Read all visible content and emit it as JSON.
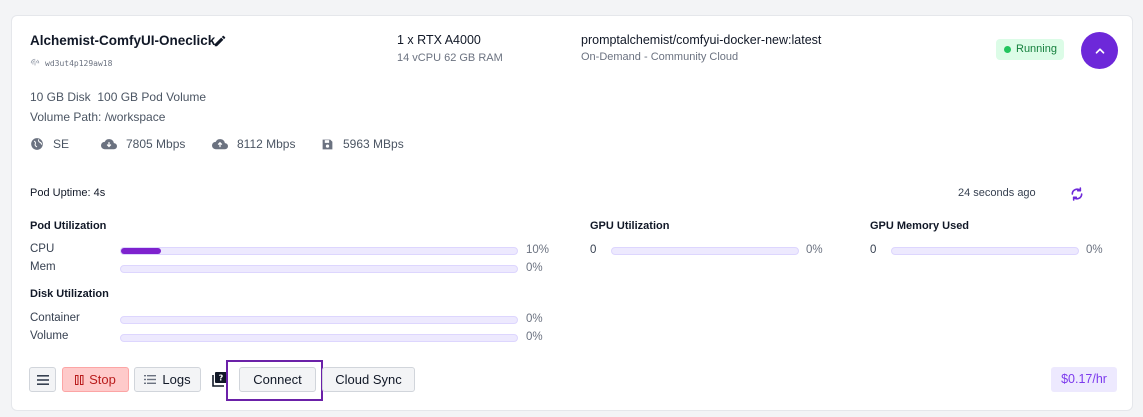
{
  "pod": {
    "name": "Alchemist-ComfyUI-Oneclick",
    "id": "wd3ut4p129aw18",
    "gpu": "1 x RTX A4000",
    "cpu_ram": "14 vCPU 62 GB RAM",
    "image": "promptalchemist/comfyui-docker-new:latest",
    "cloud": "On-Demand - Community Cloud",
    "status": "Running",
    "disk": "10 GB Disk",
    "pod_volume": "100 GB Pod Volume",
    "volume_path": "Volume Path: /workspace"
  },
  "stats": {
    "region": "SE",
    "download": "7805 Mbps",
    "upload": "8112 Mbps",
    "disk_speed": "5963 MBps"
  },
  "uptime": "Pod Uptime: 4s",
  "updated": "24 seconds ago",
  "utilization": {
    "pod_title": "Pod Utilization",
    "cpu_label": "CPU",
    "cpu_pct": "10%",
    "cpu_value": 0.1,
    "mem_label": "Mem",
    "mem_pct": "0%",
    "mem_value": 0,
    "disk_title": "Disk Utilization",
    "container_label": "Container",
    "container_pct": "0%",
    "container_value": 0,
    "volume_label": "Volume",
    "volume_pct": "0%",
    "volume_value": 0,
    "gpu_title": "GPU Utilization",
    "gpu_index": "0",
    "gpu_pct": "0%",
    "gpu_value": 0,
    "gpumem_title": "GPU Memory Used",
    "gpumem_index": "0",
    "gpumem_pct": "0%",
    "gpumem_value": 0
  },
  "actions": {
    "stop": "Stop",
    "logs": "Logs",
    "connect": "Connect",
    "cloud_sync": "Cloud Sync"
  },
  "price": "$0.17/hr",
  "colors": {
    "accent": "#6d28d9",
    "bar_fill": "#7e22ce",
    "running": "#15803d",
    "stop": "#b91c1c"
  }
}
